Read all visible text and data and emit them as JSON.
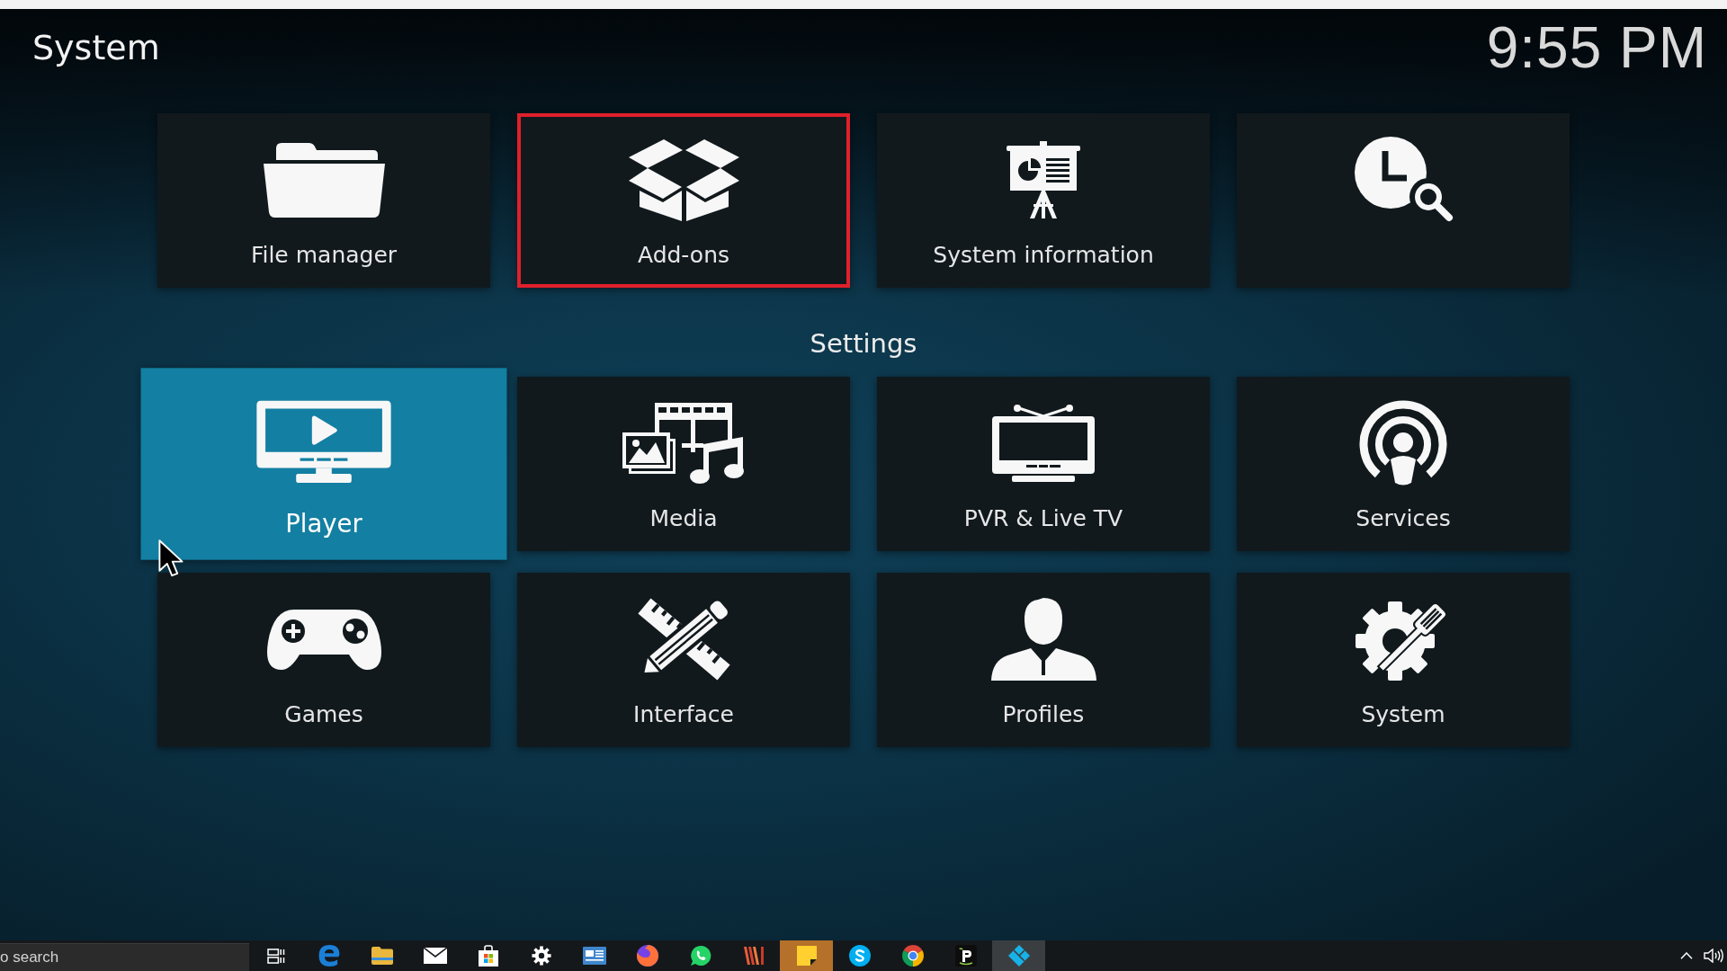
{
  "header": {
    "title": "System",
    "clock": "9:55 PM"
  },
  "shortcuts": [
    {
      "label": "File manager",
      "selected": false,
      "highlighted": false
    },
    {
      "label": "Add-ons",
      "selected": false,
      "highlighted": true
    },
    {
      "label": "System information",
      "selected": false,
      "highlighted": false
    },
    {
      "selected": false,
      "highlighted": false
    }
  ],
  "settings": {
    "heading": "Settings",
    "tiles": [
      {
        "label": "Player",
        "selected": true,
        "highlighted": false
      },
      {
        "label": "Media",
        "selected": false,
        "highlighted": false
      },
      {
        "label": "PVR & Live TV",
        "selected": false,
        "highlighted": false
      },
      {
        "label": "Services",
        "selected": false,
        "highlighted": false
      },
      {
        "label": "Games",
        "selected": false,
        "highlighted": false
      },
      {
        "label": "Interface",
        "selected": false,
        "highlighted": false
      },
      {
        "label": "Profiles",
        "selected": false,
        "highlighted": false
      },
      {
        "label": "System",
        "selected": false,
        "highlighted": false
      }
    ]
  },
  "taskbar": {
    "search": {
      "placeholder": "o search"
    },
    "apps": [
      {
        "active": false,
        "flashing": false
      },
      {
        "active": false,
        "flashing": false
      },
      {
        "active": false,
        "flashing": false
      },
      {
        "active": false,
        "flashing": false
      },
      {
        "active": false,
        "flashing": false
      },
      {
        "active": false,
        "flashing": false
      },
      {
        "active": false,
        "flashing": false
      },
      {
        "active": false,
        "flashing": false
      },
      {
        "active": false,
        "flashing": false
      },
      {
        "active": false,
        "flashing": false
      },
      {
        "active": false,
        "flashing": true
      },
      {
        "active": false,
        "flashing": false
      },
      {
        "active": false,
        "flashing": false
      },
      {
        "active": false,
        "flashing": false
      },
      {
        "active": true,
        "flashing": false
      }
    ]
  }
}
